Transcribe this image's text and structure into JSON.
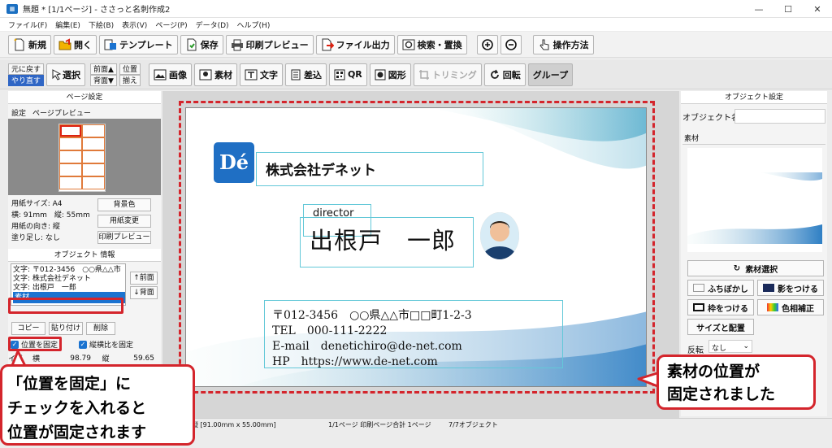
{
  "window": {
    "title": "無題 * [1/1ページ] - ささっと名刺作成2",
    "minimize": "—",
    "maximize": "☐",
    "close": "✕"
  },
  "menu": [
    "ファイル(F)",
    "編集(E)",
    "下絵(B)",
    "表示(V)",
    "ページ(P)",
    "データ(D)",
    "ヘルプ(H)"
  ],
  "toolbar": {
    "new": "新規",
    "open": "開く",
    "template": "テンプレート",
    "save": "保存",
    "print_preview": "印刷プレビュー",
    "file_output": "ファイル出力",
    "search_replace": "検索・置換",
    "help": "操作方法"
  },
  "toolbar2": {
    "undo": "元に戻す",
    "redo": "やり直す",
    "select": "選択",
    "front": "前面▲",
    "back": "背面▼",
    "align_top": "位置",
    "align_bottom": "揃え",
    "image": "画像",
    "material": "素材",
    "text": "文字",
    "merge": "差込",
    "qr": "QR",
    "shape": "図形",
    "trimming": "トリミング",
    "rotate": "回転",
    "group": "グループ"
  },
  "page_settings": {
    "header": "ページ設定",
    "tab_settings": "設定",
    "tab_preview": "ページプレビュー",
    "paper_size": "用紙サイズ: A4",
    "dimensions": "横: 91mm　縦: 55mm",
    "orientation": "用紙の向き: 縦",
    "bleed": "塗り足し: なし",
    "bg_color_btn": "背景色",
    "change_paper_btn": "用紙変更",
    "print_preview_btn": "印刷プレビュー"
  },
  "object_info": {
    "header": "オブジェクト 情報",
    "list": [
      "文字: 〒012-3456　○○県△△市",
      "文字: 株式会社デネット",
      "文字: 出根戸　一郎"
    ],
    "selected": "素材",
    "front_btn": "↑前面",
    "back_btn": "↓背面",
    "copy_btn": "コピー",
    "paste_btn": "貼り付け",
    "delete_btn": "削除",
    "fix_position": "位置を固定",
    "fix_aspect": "縦横比を固定",
    "size_label": "イズ",
    "width_label": "横",
    "width_value": "98.79",
    "height_label": "縦",
    "height_value": "59.65"
  },
  "card": {
    "logo": "Dé",
    "company": "株式会社デネット",
    "title": "director",
    "name": "出根戸　一郎",
    "postal": "〒012-3456　○○県△△市□□町1-2-3",
    "tel": "TEL　000-111-2222",
    "email": "E-mail　denetichiro@de-net.com",
    "hp": "HP　https://www.de-net.com"
  },
  "object_settings": {
    "header": "オブジェクト設定",
    "name_label": "オブジェクト名",
    "name_value": "",
    "material_tab": "素材",
    "select_material_btn": "素材選択",
    "blur_btn": "ふちぼかし",
    "shadow_btn": "影をつける",
    "frame_btn": "枠をつける",
    "color_correct_btn": "色相補正",
    "size_position_btn": "サイズと配置",
    "flip_label": "反転",
    "flip_value": "なし"
  },
  "status": {
    "size": "縦 [91.00mm x 55.00mm]",
    "page": "1/1ページ 印刷ページ合計 1ページ",
    "objects": "7/7オブジェクト"
  },
  "callouts": {
    "left_line1": "「位置を固定」に",
    "left_line2": "チェックを入れると",
    "left_line3": "位置が固定されます",
    "right_line1": "素材の位置が",
    "right_line2": "固定されました"
  },
  "colors": {
    "accent_red": "#d4252c",
    "selection_blue": "#1b73d0",
    "brand_blue": "#1f6fc4",
    "teal": "#63c8d8"
  }
}
